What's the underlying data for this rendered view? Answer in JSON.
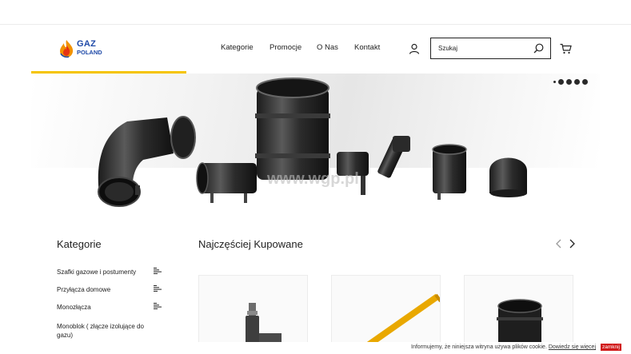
{
  "brand": {
    "line1": "GAZ",
    "line2": "POLAND",
    "primary_color": "#1f4aa8",
    "accent_color": "#f5c400"
  },
  "nav": {
    "items": [
      {
        "label": "Kategorie"
      },
      {
        "label": "Promocje"
      },
      {
        "label": "O Nas"
      },
      {
        "label": "Kontakt"
      }
    ]
  },
  "header": {
    "user_icon": "user-icon",
    "cart_icon": "cart-icon"
  },
  "search": {
    "placeholder": "Szukaj",
    "value": "",
    "icon": "search-icon"
  },
  "hero": {
    "watermark": "www.wgp.pl",
    "active_slide": 1,
    "slide_count": 5
  },
  "sidebar": {
    "title": "Kategorie",
    "items": [
      {
        "label": "Szafki gazowe i postumenty",
        "icon": "list-icon"
      },
      {
        "label": "Przyłącza domowe",
        "icon": "list-icon"
      },
      {
        "label": "Monozłącza",
        "icon": "list-icon"
      },
      {
        "label": "Monoblok ( złącze izolujące do gazu)",
        "icon": ""
      }
    ]
  },
  "bestsellers": {
    "title": "Najczęściej Kupowane",
    "prev_icon": "chevron-left-icon",
    "next_icon": "chevron-right-icon",
    "products": [
      {
        "image": "tee-fitting"
      },
      {
        "image": "yellow-riser-pipe"
      },
      {
        "image": "electrofusion-coupler"
      }
    ]
  },
  "cookie": {
    "message": "Informujemy, że niniejsza witryna używa plików cookie.",
    "link_label": "Dowiedz się więcej",
    "close_label": "zamknij",
    "close_color": "#d11a1a"
  }
}
